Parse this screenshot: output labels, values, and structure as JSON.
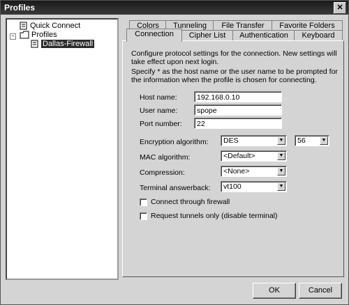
{
  "window": {
    "title": "Profiles",
    "close_glyph": "✕"
  },
  "tree": {
    "quick_connect": "Quick Connect",
    "profiles": "Profiles",
    "selected_profile": "Dallas-Firewall"
  },
  "tabs": {
    "row1": [
      "Colors",
      "Tunneling",
      "File Transfer",
      "Favorite Folders"
    ],
    "row2": [
      "Connection",
      "Cipher List",
      "Authentication",
      "Keyboard"
    ],
    "active": "Connection"
  },
  "connection": {
    "desc1": "Configure protocol settings for the connection. New settings will take effect upon next login.",
    "desc2": "Specify * as the host name or the user name to be prompted for the information when the profile is chosen for connecting.",
    "host_label": "Host name:",
    "host_value": "192.168.0.10",
    "user_label": "User name:",
    "user_value": "spope",
    "port_label": "Port number:",
    "port_value": "22",
    "enc_label": "Encryption algorithm:",
    "enc_value": "DES",
    "enc_bits": "56",
    "mac_label": "MAC algorithm:",
    "mac_value": "<Default>",
    "comp_label": "Compression:",
    "comp_value": "<None>",
    "term_label": "Terminal answerback:",
    "term_value": "vt100",
    "firewall_label": "Connect through firewall",
    "tunnels_label": "Request tunnels only (disable terminal)"
  },
  "buttons": {
    "ok": "OK",
    "cancel": "Cancel"
  }
}
